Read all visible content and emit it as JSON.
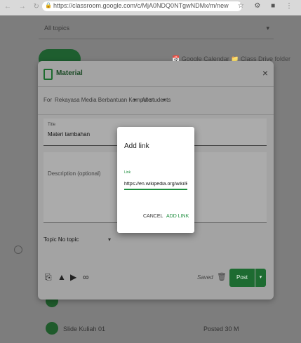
{
  "browser": {
    "url": "https://classroom.google.com/c/MjA0NDQ0NTgwNDMx/m/new",
    "nav_icons": "← → ↻",
    "right_icons": "☆ ⚙ ■ ⋮"
  },
  "background": {
    "topic_filter": "All topics",
    "caret": "▾",
    "links_right": "📅 Google Calendar  📁 Class Drive folder",
    "item_label": "Slide Kuliah 01",
    "item_date": "Posted 30 M"
  },
  "material_dialog": {
    "title": "Material",
    "close_icon": "×",
    "for_label": "For",
    "class_name": "Rekayasa Media Berbantuan Komputer",
    "students": "All students",
    "title_field_label": "Title",
    "title_field_value": "Materi tambahan",
    "description_placeholder": "Description (optional)",
    "topic_label": "Topic",
    "topic_value": "No topic",
    "saved_text": "Saved",
    "post_label": "Post",
    "post_dropdown": "▾"
  },
  "add_link_dialog": {
    "title": "Add link",
    "link_label": "Link",
    "link_value": "https://en.wikipedia.org/wiki/Bic",
    "cancel_label": "CANCEL",
    "add_label": "ADD LINK"
  },
  "colors": {
    "accent_green": "#1e8e3e",
    "post_button": "#1d6b31"
  }
}
